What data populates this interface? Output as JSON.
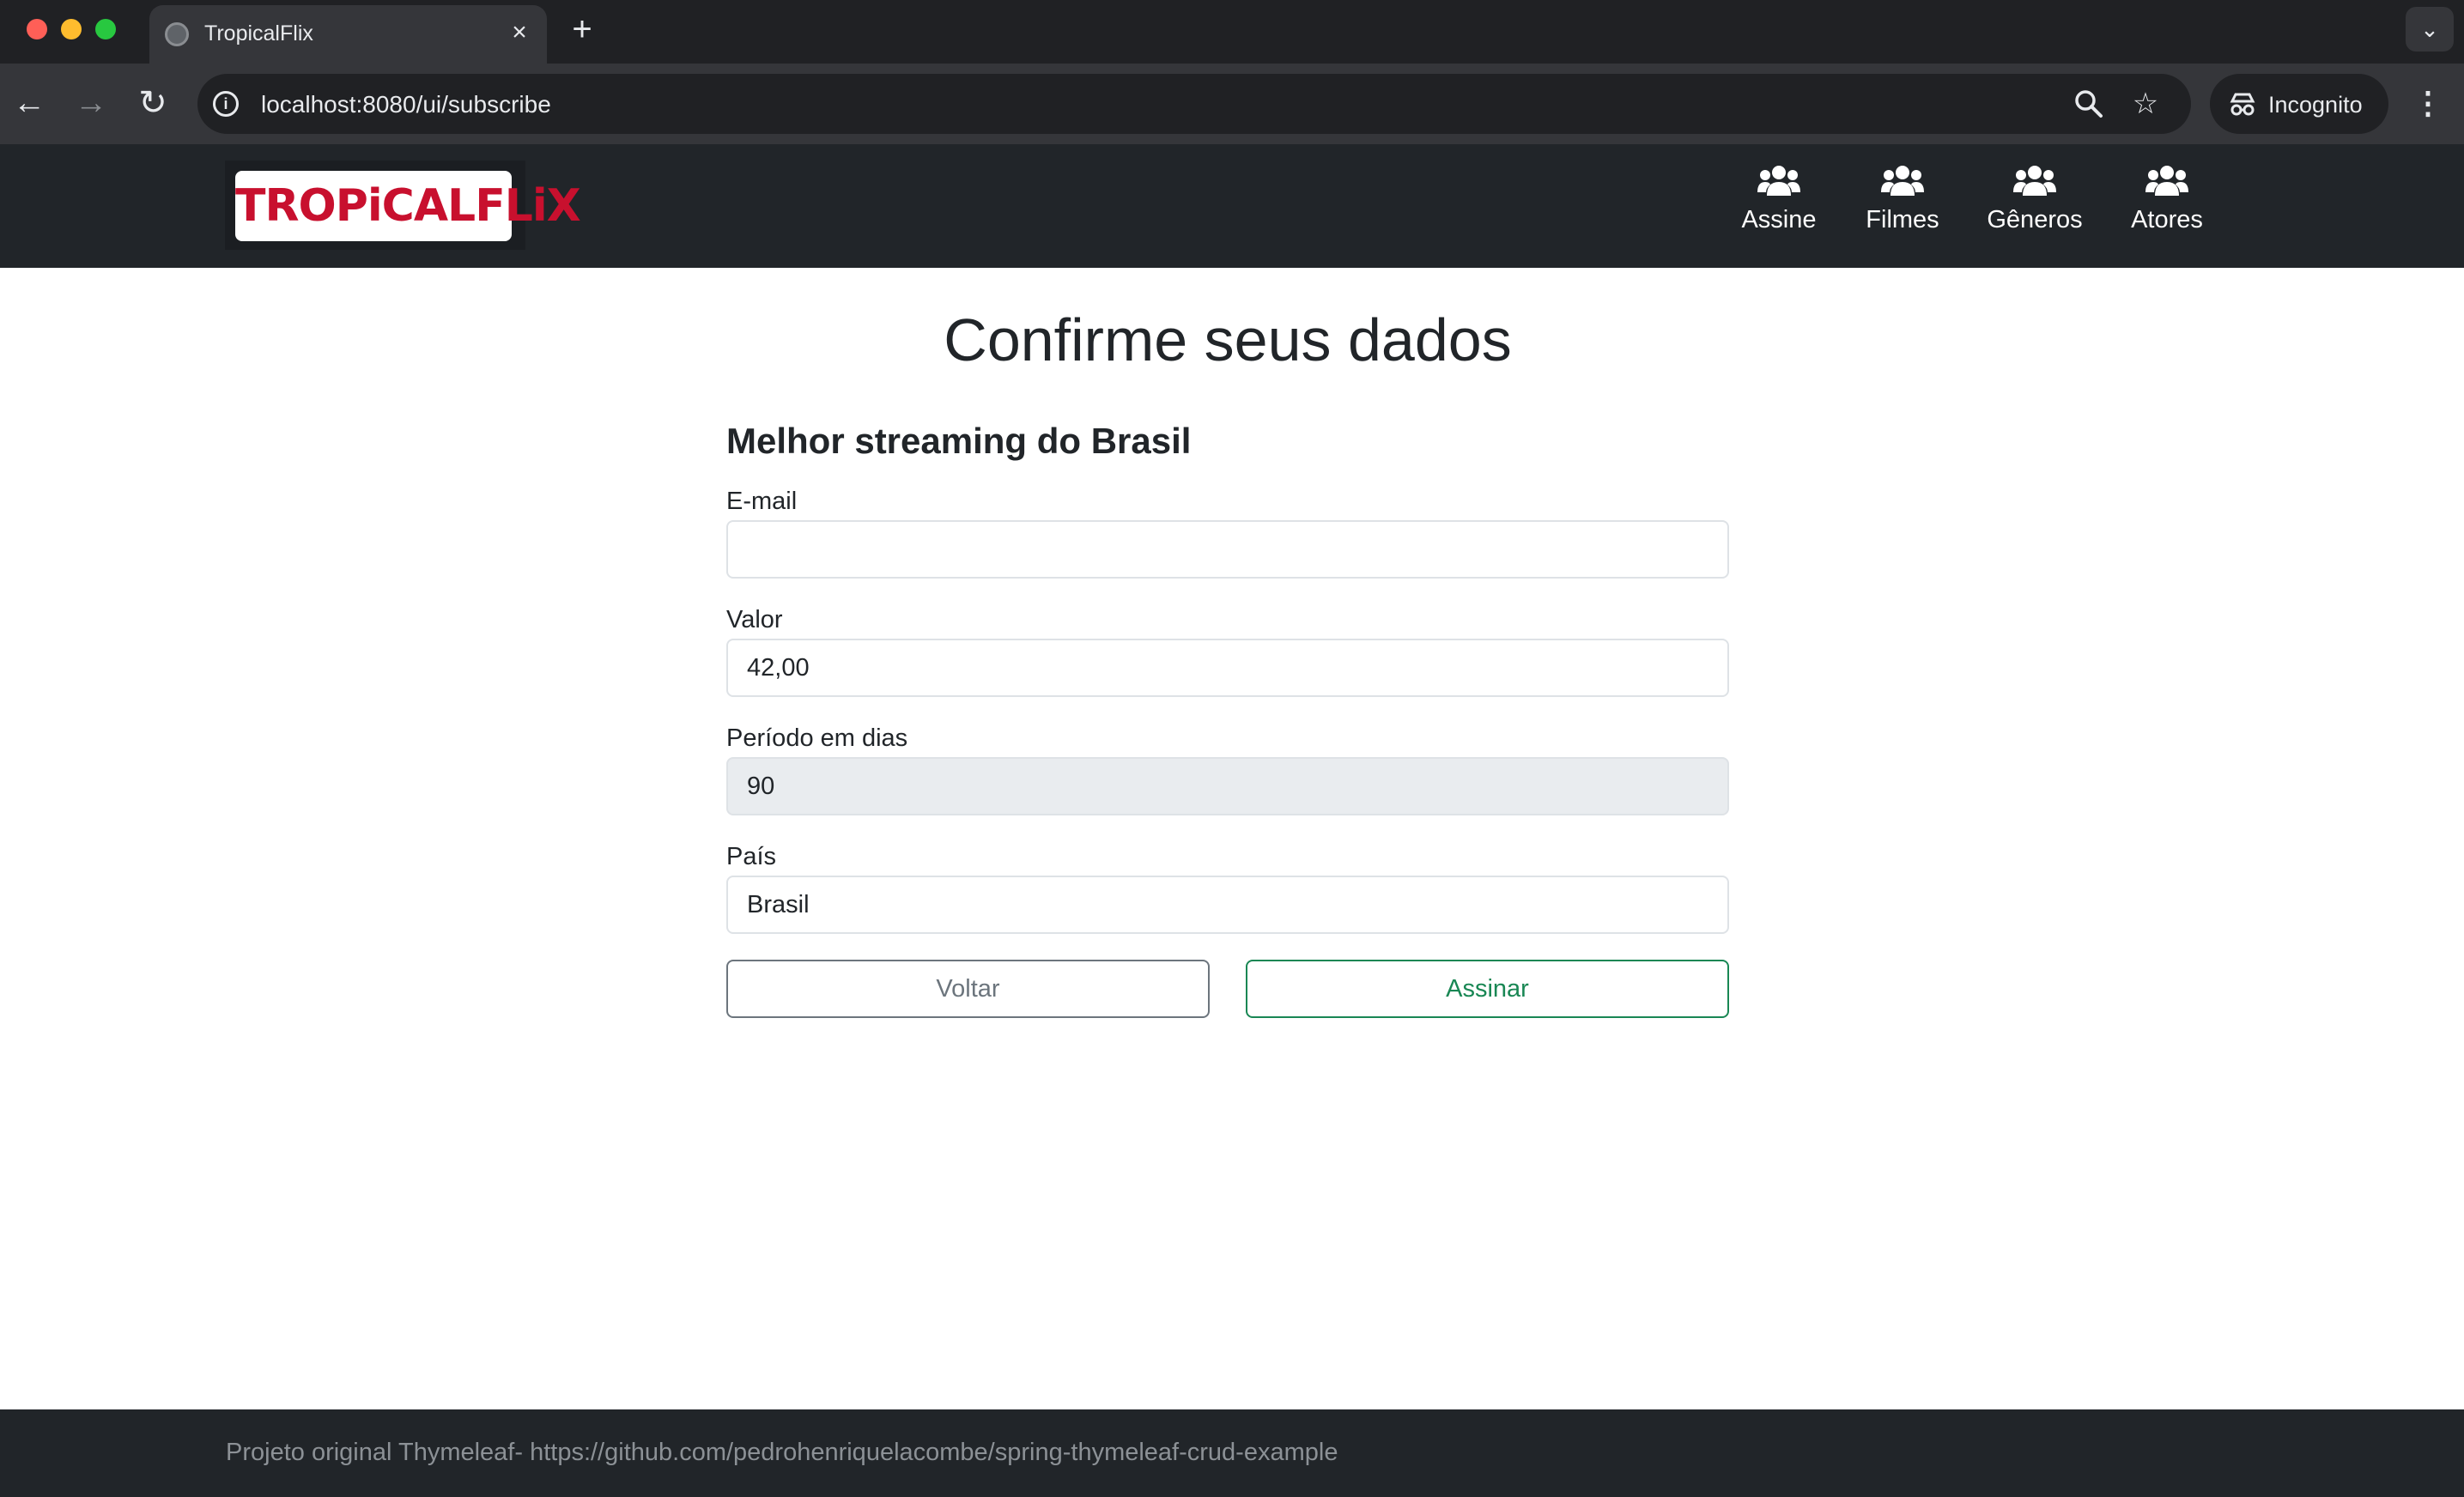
{
  "browser": {
    "tab_title": "TropicalFlix",
    "url": "localhost:8080/ui/subscribe",
    "incognito_label": "Incognito",
    "icons": {
      "back": "arrow-left-icon",
      "forward": "arrow-right-icon",
      "reload": "reload-icon",
      "site_info": "info-icon",
      "zoom": "magnifier-icon",
      "bookmark": "star-icon",
      "menu": "kebab-menu-icon"
    }
  },
  "navbar": {
    "brand": "TROPiCALFLiX",
    "items": [
      {
        "label": "Assine",
        "icon": "users-icon"
      },
      {
        "label": "Filmes",
        "icon": "users-icon"
      },
      {
        "label": "Gêneros",
        "icon": "users-icon"
      },
      {
        "label": "Atores",
        "icon": "users-icon"
      }
    ]
  },
  "page": {
    "title": "Confirme seus dados"
  },
  "form": {
    "subtitle": "Melhor streaming do Brasil",
    "email": {
      "label": "E-mail",
      "value": ""
    },
    "valor": {
      "label": "Valor",
      "value": "42,00"
    },
    "periodo": {
      "label": "Período em dias",
      "value": "90"
    },
    "pais": {
      "label": "País",
      "value": "Brasil"
    },
    "back_label": "Voltar",
    "submit_label": "Assinar"
  },
  "footer": {
    "text": "Projeto original Thymeleaf- https://github.com/pedrohenriquelacombe/spring-thymeleaf-crud-example"
  },
  "colors": {
    "navbar_bg": "#212529",
    "brand_red": "#c8102e",
    "submit_green": "#198754",
    "back_gray": "#6c757d",
    "readonly_bg": "#e9ecef"
  }
}
